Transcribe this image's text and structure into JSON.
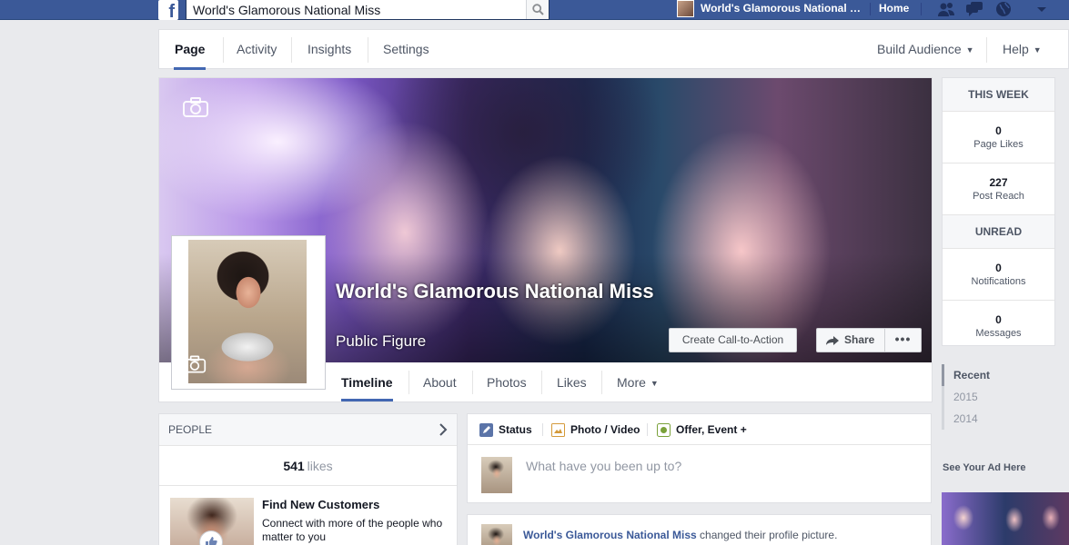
{
  "topbar": {
    "logo_letter": "f",
    "search_value": "World's Glamorous National Miss",
    "page_name": "World's Glamorous National Miss",
    "home_label": "Home",
    "icons": [
      "friends-icon",
      "messages-icon",
      "notifications-globe-icon",
      "account-menu-caret-icon"
    ]
  },
  "pagenav": {
    "tabs": [
      "Page",
      "Activity",
      "Insights",
      "Settings"
    ],
    "active": "Page",
    "build_audience": "Build Audience",
    "help": "Help"
  },
  "cover": {
    "page_title": "World's Glamorous National Miss",
    "category": "Public Figure",
    "cta_label": "Create Call-to-Action",
    "share_label": "Share",
    "more_label": "•••"
  },
  "timeline_tabs": {
    "items": [
      "Timeline",
      "About",
      "Photos",
      "Likes",
      "More"
    ],
    "active": "Timeline"
  },
  "stats": {
    "this_week_label": "THIS WEEK",
    "page_likes": {
      "value": "0",
      "label": "Page Likes"
    },
    "post_reach": {
      "value": "227",
      "label": "Post Reach"
    },
    "unread_label": "UNREAD",
    "notifications": {
      "value": "0",
      "label": "Notifications"
    },
    "messages": {
      "value": "0",
      "label": "Messages"
    }
  },
  "years": [
    "Recent",
    "2015",
    "2014"
  ],
  "ad": {
    "heading": "See Your Ad Here"
  },
  "people": {
    "heading": "PEOPLE",
    "likes_count": "541",
    "likes_label": "likes",
    "promo_title": "Find New Customers",
    "promo_text": "Connect with more of the people who matter to you"
  },
  "composer": {
    "tabs": [
      "Status",
      "Photo / Video",
      "Offer, Event +"
    ],
    "placeholder": "What have you been up to?"
  },
  "story": {
    "actor": "World's Glamorous National Miss",
    "action": "changed their profile picture."
  },
  "colors": {
    "brand_blue": "#3b5998",
    "active_tab_underline": "#4267b2",
    "page_background": "#e9eaed"
  }
}
